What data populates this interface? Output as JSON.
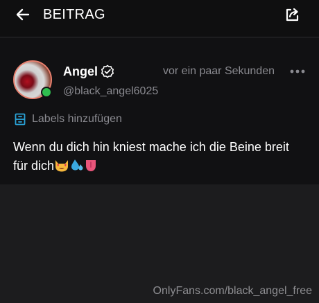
{
  "header": {
    "title": "BEITRAG",
    "back_icon": "arrow-left-icon",
    "share_icon": "share-icon"
  },
  "post": {
    "author_name": "Angel",
    "verified_icon": "verified-badge-icon",
    "handle": "@black_angel6025",
    "timestamp": "vor ein paar Sekunden",
    "more_icon": "more-dots-icon",
    "labels_label": "Labels hinzufügen",
    "labels_icon": "labels-icon",
    "text_line1": "Wenn du dich hin kniest mache ich die Beine breit",
    "text_line2": "für dich",
    "emoji": [
      "smiling-cat-heart-eyes",
      "sweat-droplets",
      "tongue"
    ]
  },
  "watermark": "OnlyFans.com/black_angel_free",
  "colors": {
    "background": "#1c1c1e",
    "topbar": "#0f0f10",
    "card": "#111113",
    "secondary_text": "#8a8a90",
    "avatar_ring": "#e7806f",
    "online": "#2fbf4f",
    "labels_icon": "#2aa3d8"
  }
}
